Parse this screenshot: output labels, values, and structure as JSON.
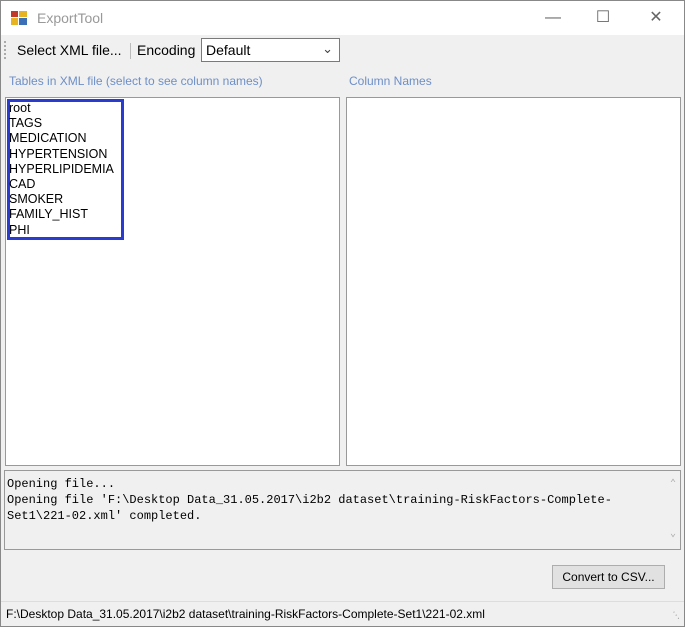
{
  "window": {
    "title": "ExportTool"
  },
  "toolbar": {
    "select_label": "Select XML file...",
    "encoding_label": "Encoding",
    "encoding_value": "Default"
  },
  "tables": {
    "label": "Tables in XML file (select to see column names)",
    "items": [
      "root",
      "TAGS",
      "MEDICATION",
      "HYPERTENSION",
      "HYPERLIPIDEMIA",
      "CAD",
      "SMOKER",
      "FAMILY_HIST",
      "PHI"
    ]
  },
  "columns": {
    "label": "Column Names"
  },
  "log": {
    "text": "Opening file...\nOpening file 'F:\\Desktop Data_31.05.2017\\i2b2 dataset\\training-RiskFactors-Complete-Set1\\221-02.xml' completed."
  },
  "actions": {
    "convert_label": "Convert to CSV..."
  },
  "status": {
    "path": "F:\\Desktop Data_31.05.2017\\i2b2 dataset\\training-RiskFactors-Complete-Set1\\221-02.xml"
  },
  "colors": {
    "highlight": "#2a3ccf",
    "label": "#6d8fc7"
  }
}
